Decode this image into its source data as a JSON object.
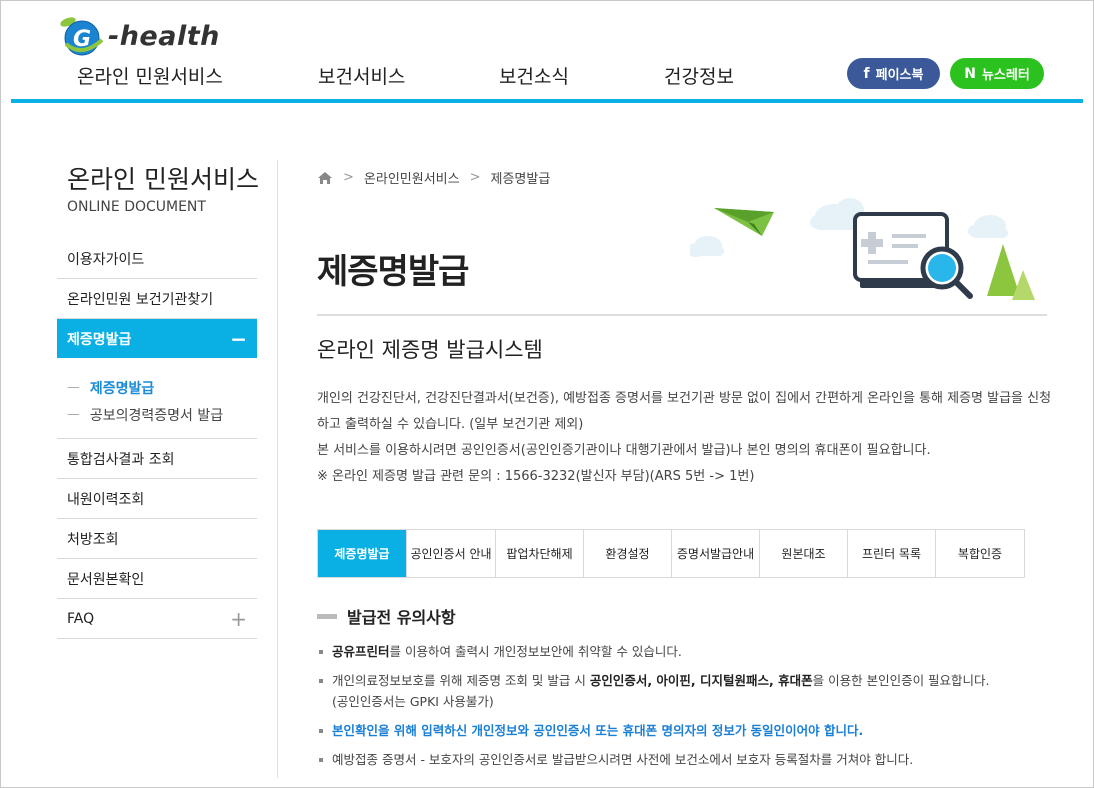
{
  "header": {
    "logo_text": "-health",
    "nav": [
      "온라인 민원서비스",
      "보건서비스",
      "보건소식",
      "건강정보"
    ],
    "facebook_label": "페이스북",
    "facebook_icon": "f",
    "newsletter_label": "뉴스레터",
    "newsletter_icon": "N",
    "colors": {
      "accent": "#0ab0e3",
      "facebook": "#3b5998",
      "newsletter": "#2bc11e"
    }
  },
  "sidebar": {
    "title": "온라인 민원서비스",
    "subtitle": "ONLINE DOCUMENT",
    "items": [
      {
        "label": "이용자가이드"
      },
      {
        "label": "온라인민원 보건기관찾기"
      },
      {
        "label": "제증명발급",
        "toggle": "−",
        "active": true
      },
      {
        "label": "통합검사결과 조회"
      },
      {
        "label": "내원이력조회"
      },
      {
        "label": "처방조회"
      },
      {
        "label": "문서원본확인"
      },
      {
        "label": "FAQ",
        "toggle": "+"
      }
    ],
    "subitems": [
      {
        "label": "제증명발급",
        "dash": "ㅡ",
        "active": true
      },
      {
        "label": "공보의경력증명서 발급",
        "dash": "ㅡ"
      }
    ]
  },
  "breadcrumb": {
    "items": [
      "온라인민원서비스",
      "제증명발급"
    ],
    "separator": ">"
  },
  "main": {
    "title": "제증명발급",
    "section_title": "온라인 제증명 발급시스템",
    "description": [
      "개인의 건강진단서, 건강진단결과서(보건증), 예방접종 증명서를 보건기관 방문 없이 집에서 간편하게 온라인을 통해 제증명 발급을 신청 하고 출력하실 수 있습니다. (일부 보건기관 제외)",
      "본 서비스를 이용하시려면 공인인증서(공인인증기관이나 대행기관에서 발급)나 본인 명의의 휴대폰이 필요합니다.",
      "※ 온라인 제증명 발급 관련 문의 : 1566-3232(발신자 부담)(ARS 5번 -> 1번)"
    ],
    "tabs": [
      "제증명발급",
      "공인인증서 안내",
      "팝업차단해제",
      "환경설정",
      "증명서발급안내",
      "원본대조",
      "프린터 목록",
      "복합인증"
    ],
    "active_tab": 0,
    "notice_title": "발급전 유의사항",
    "notice": {
      "n1_bold": "공유프린터",
      "n1_rest": "를 이용하여 출력시 개인정보보안에 취약할 수 있습니다.",
      "n2_pre": "개인의료정보보호를 위해 제증명 조회 및 발급 시 ",
      "n2_b1": "공인인증서, 아이핀, 디지털원패스, 휴대폰",
      "n2_post": "을 이용한 본인인증이 필요합니다.",
      "n2_line2": "(공인인증서는 GPKI 사용불가)",
      "n3": "본인확인을 위해 입력하신 개인정보와 공인인증서 또는 휴대폰 명의자의 정보가 동일인이어야 합니다.",
      "n4": "예방접종 증명서 - 보호자의 공인인증서로 발급받으시려면 사전에 보건소에서 보호자 등록절차를 거쳐야 합니다."
    }
  }
}
